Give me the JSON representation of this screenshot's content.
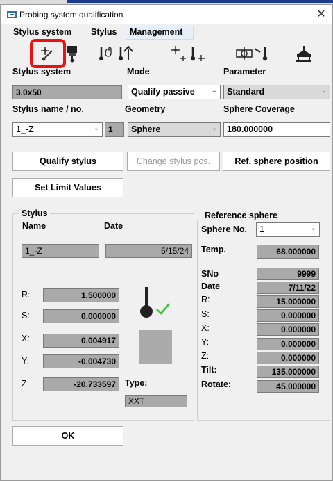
{
  "window": {
    "title": "Probing system qualification",
    "close_label": "✕"
  },
  "menu": [
    "Stylus system",
    "Stylus",
    "Management"
  ],
  "toolbar": [
    {
      "icon": "qualify-stylus-icon"
    },
    {
      "icon": "probe-head-icon"
    },
    {
      "icon": "manual-probe-icon"
    },
    {
      "icon": "probe-arrow-icon"
    },
    {
      "icon": "probe-plus-icon"
    },
    {
      "icon": "stylus-plus-icon"
    },
    {
      "icon": "reference-sphere-icon"
    },
    {
      "icon": "angled-stylus-icon"
    },
    {
      "icon": "table-probe-icon"
    }
  ],
  "stylus_system": {
    "label": "Stylus system",
    "value": "3.0x50"
  },
  "mode": {
    "label": "Mode",
    "value": "Qualify passive"
  },
  "parameter": {
    "label": "Parameter",
    "value": "Standard"
  },
  "stylus_name": {
    "label": "Stylus name / no.",
    "value": "1_-Z",
    "number": "1"
  },
  "geometry": {
    "label": "Geometry",
    "value": "Sphere"
  },
  "sphere_coverage": {
    "label": "Sphere Coverage",
    "value": "180.000000"
  },
  "buttons": {
    "qualify_stylus": "Qualify stylus",
    "change_stylus_pos": "Change stylus pos.",
    "ref_sphere_position": "Ref. sphere position",
    "set_limit_values": "Set Limit Values",
    "ok": "OK"
  },
  "stylus_group": {
    "title": "Stylus",
    "name_label": "Name",
    "date_label": "Date",
    "name": "1_-Z",
    "date": "5/15/24",
    "R_label": "R:",
    "R": "1.500000",
    "S_label": "S:",
    "S": "0.000000",
    "X_label": "X:",
    "X": "0.004917",
    "Y_label": "Y:",
    "Y": "-0.004730",
    "Z_label": "Z:",
    "Z": "-20.733597",
    "type_label": "Type:",
    "type": "XXT"
  },
  "reference_sphere": {
    "title": "Reference sphere",
    "sphere_no_label": "Sphere No.",
    "sphere_no": "1",
    "temp_label": "Temp.",
    "temp": "68.000000",
    "sno_label": "SNo",
    "sno": "9999",
    "date_label": "Date",
    "date": "7/11/22",
    "R_label": "R:",
    "R": "15.000000",
    "S_label": "S:",
    "S": "0.000000",
    "X_label": "X:",
    "X": "0.000000",
    "Y_label": "Y:",
    "Y": "0.000000",
    "Z_label": "Z:",
    "Z": "0.000000",
    "tilt_label": "Tilt:",
    "tilt": "135.000000",
    "rotate_label": "Rotate:",
    "rotate": "45.000000"
  },
  "colors": {
    "highlight": "#ee1111",
    "field_grey": "#a9a9a9",
    "dialog_bg": "#f0f0f0",
    "check_green": "#3cc43c"
  }
}
